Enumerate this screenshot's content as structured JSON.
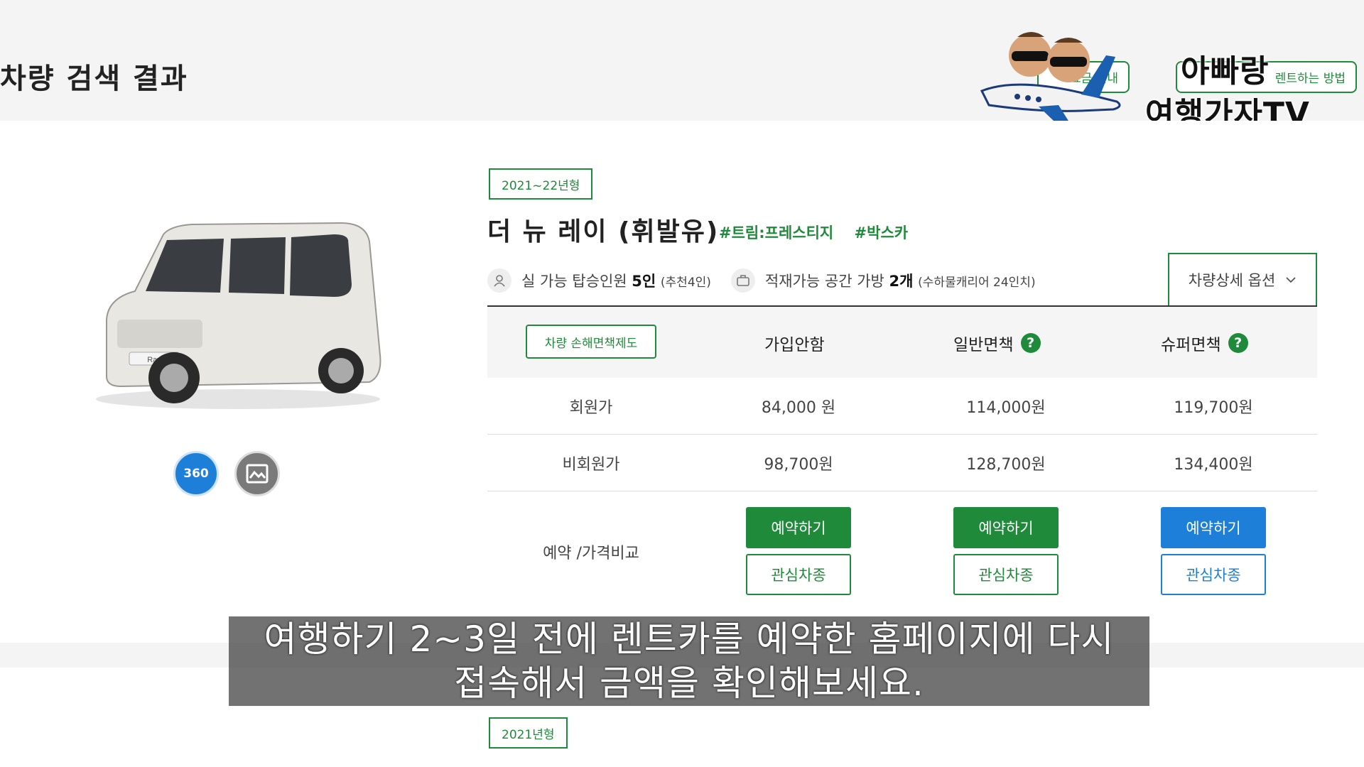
{
  "page": {
    "title": "차량 검색 결과"
  },
  "header": {
    "links": [
      {
        "label": "요금 안내"
      },
      {
        "label": "렌트하는 방법"
      }
    ]
  },
  "logo": {
    "line1": "아빠랑",
    "line2": "여행가자TV"
  },
  "car": {
    "year_badge": "2021~22년형",
    "name": "더 뉴 레이 (휘발유)",
    "tags": [
      "#트림:프레스티지",
      "#박스카"
    ],
    "image_label": "Ray",
    "view_360_label": "360",
    "specs": {
      "passengers_prefix": "실 가능 탑승인원",
      "passengers_value": "5인",
      "passengers_note": "(추천4인)",
      "luggage_prefix": "적재가능 공간 가방",
      "luggage_value": "2개",
      "luggage_note": "(수하물캐리어 24인치)"
    },
    "detail_options_label": "차량상세 옵션"
  },
  "table": {
    "insurance_button": "차량 손해면책제도",
    "columns": [
      "가입안함",
      "일반면책",
      "슈퍼면책"
    ],
    "help_symbol": "?",
    "rows": [
      {
        "label": "회원가",
        "values": [
          "84,000 원",
          "114,000원",
          "119,700원"
        ]
      },
      {
        "label": "비회원가",
        "values": [
          "98,700원",
          "128,700원",
          "134,400원"
        ]
      }
    ],
    "action_label": "예약 /가격비교",
    "reserve_label": "예약하기",
    "favorite_label": "관심차종"
  },
  "colors": {
    "green": "#1f8a3a",
    "blue": "#1e7fd8"
  },
  "next_car": {
    "year_badge": "2021년형"
  },
  "subtitle": {
    "line1": "여행하기 2~3일 전에 렌트카를 예약한 홈페이지에 다시",
    "line2": "접속해서 금액을 확인해보세요."
  }
}
